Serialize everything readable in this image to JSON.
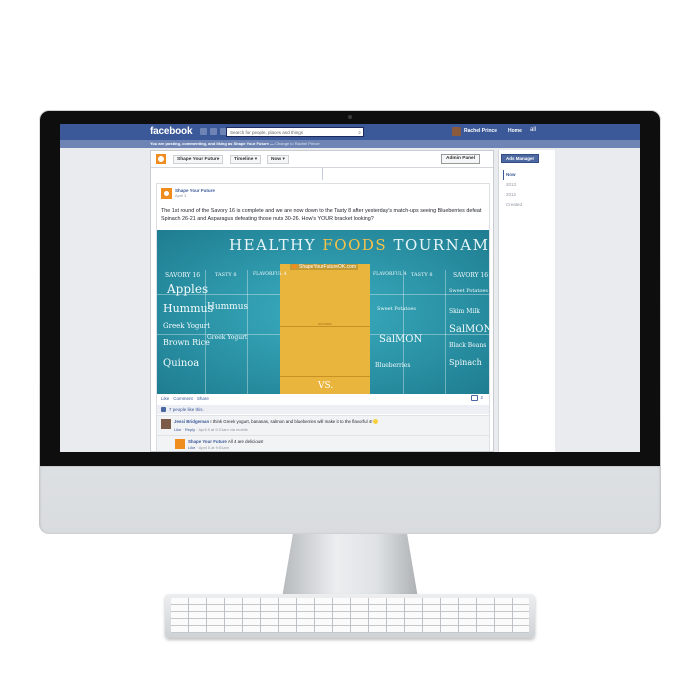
{
  "facebook": {
    "logo": "facebook",
    "search_placeholder": "Search for people, places and things",
    "user_name": "Rachel Prince",
    "home": "Home",
    "nav_count": "all"
  },
  "notice": {
    "text": "You are posting, commenting, and liking as Shape Your Future — ",
    "link": "Change to Rachel Prince"
  },
  "page_nav": {
    "page_name": "Shape Your Future",
    "timeline": "Timeline ▾",
    "now": "Now ▾",
    "admin_panel": "Admin Panel"
  },
  "post": {
    "author": "Shape Your Future",
    "time": "April 3",
    "text": "The 1st round of the Savory 16 is complete and we are now down to the Tasty 8 after yesterday's match-ups seeing Blueberries defeat Spinach 26-21 and Asparagus defeating those nuts 30-26. How's YOUR bracket looking?",
    "image": {
      "title_a": "HEALTHY ",
      "title_b": "FOODS",
      "title_c": " TOURNAMENT",
      "website": "ShapeYourFutureOK.com",
      "left_header": "SAVORY 16",
      "tasty_left": "TASTY 8",
      "flavorful_left": "FLAVORFUL 4",
      "flavorful_right": "FLAVORFUL 4",
      "tasty_right": "TASTY 8",
      "right_header": "SAVORY 16",
      "winner": "WINNER",
      "vs": "VS.",
      "left_col1": [
        "Apples",
        "Hummus",
        "Greek Yogurt",
        "Brown Rice",
        "Quinoa"
      ],
      "left_col2": [
        "Hummus",
        "Greek Yogurt"
      ],
      "right_col1": [
        "Sweet Potatoes",
        "SalMON",
        "Blueberries"
      ],
      "right_col2": [
        "Sweet Potatoes",
        "Skim Milk",
        "SalMON",
        "Black Beans",
        "Spinach"
      ]
    },
    "actions": {
      "like": "Like",
      "comment": "Comment",
      "share": "Share"
    },
    "share_count": "2",
    "likes": "7 people like this."
  },
  "comments": [
    {
      "author": "Jessi Bridgeman",
      "text": "I think Greek yogurt, bananas, salmon and blueberries will make it to the flavorful 4!",
      "meta_like": "Like",
      "meta_reply": "Reply",
      "meta_rest": "April 5 at 9:21am via mobile"
    },
    {
      "author": "Shape Your Future",
      "text": "All 4 are delicious!",
      "meta_like": "Like",
      "meta_rest": "April 5 at 9:51am"
    }
  ],
  "sidebar": {
    "ads_manager": "Ads Manager",
    "years": [
      "Now",
      "2013",
      "2012",
      "Created"
    ]
  }
}
